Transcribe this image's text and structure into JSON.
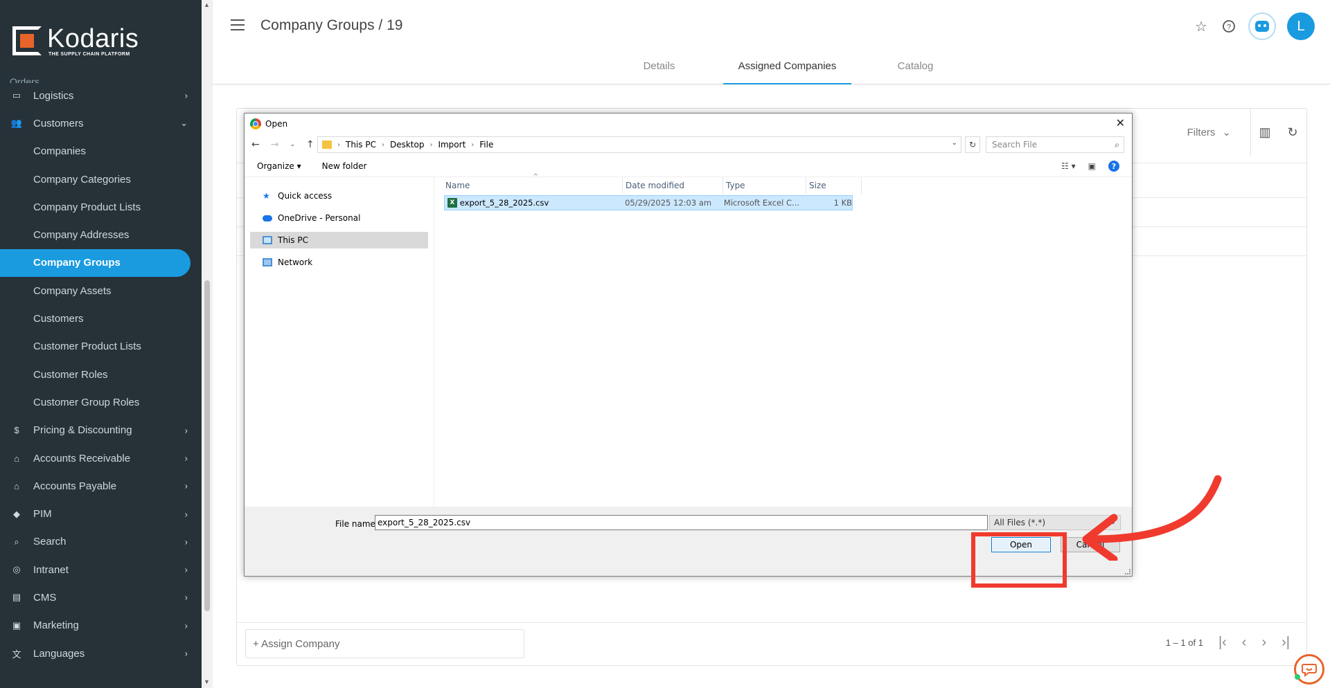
{
  "brand": {
    "name": "Kodaris",
    "tagline": "THE SUPPLY CHAIN PLATFORM",
    "accent": "#1a9be0",
    "logo_color": "#e8632a"
  },
  "sidebar": {
    "partial_item": "Orders",
    "items": [
      {
        "label": "Logistics",
        "icon": "truck-icon",
        "expandable": true
      },
      {
        "label": "Customers",
        "icon": "people-icon",
        "expandable": true,
        "expanded": true
      },
      {
        "label": "Companies",
        "sub": true
      },
      {
        "label": "Company Categories",
        "sub": true
      },
      {
        "label": "Company Product Lists",
        "sub": true
      },
      {
        "label": "Company Addresses",
        "sub": true
      },
      {
        "label": "Company Groups",
        "sub": true,
        "active": true
      },
      {
        "label": "Company Assets",
        "sub": true
      },
      {
        "label": "Customers",
        "sub": true
      },
      {
        "label": "Customer Product Lists",
        "sub": true
      },
      {
        "label": "Customer Roles",
        "sub": true
      },
      {
        "label": "Customer Group Roles",
        "sub": true
      },
      {
        "label": "Pricing & Discounting",
        "icon": "dollar-icon",
        "expandable": true
      },
      {
        "label": "Accounts Receivable",
        "icon": "bank-icon",
        "expandable": true
      },
      {
        "label": "Accounts Payable",
        "icon": "bank-icon",
        "expandable": true
      },
      {
        "label": "PIM",
        "icon": "tag-icon",
        "expandable": true
      },
      {
        "label": "Search",
        "icon": "search-icon",
        "expandable": true
      },
      {
        "label": "Intranet",
        "icon": "globe-icon",
        "expandable": true
      },
      {
        "label": "CMS",
        "icon": "cms-icon",
        "expandable": true
      },
      {
        "label": "Marketing",
        "icon": "megaphone-icon",
        "expandable": true
      },
      {
        "label": "Languages",
        "icon": "translate-icon",
        "expandable": true
      }
    ]
  },
  "header": {
    "title": "Company Groups / 19",
    "avatar_initial": "L",
    "tabs": [
      {
        "label": "Details",
        "active": false
      },
      {
        "label": "Assigned Companies",
        "active": true
      },
      {
        "label": "Catalog",
        "active": false
      }
    ]
  },
  "card": {
    "filters_label": "Filters",
    "assign_label": "+ Assign Company",
    "pager_text": "1 – 1 of 1"
  },
  "dialog": {
    "title": "Open",
    "breadcrumb": [
      "This PC",
      "Desktop",
      "Import",
      "File"
    ],
    "search_placeholder": "Search File",
    "organize_label": "Organize",
    "new_folder_label": "New folder",
    "nav_items": [
      {
        "label": "Quick access",
        "icon": "star-icon"
      },
      {
        "label": "OneDrive - Personal",
        "icon": "cloud-icon"
      },
      {
        "label": "This PC",
        "icon": "monitor-icon",
        "selected": true
      },
      {
        "label": "Network",
        "icon": "network-icon"
      }
    ],
    "columns": [
      "Name",
      "Date modified",
      "Type",
      "Size"
    ],
    "files": [
      {
        "name": "export_5_28_2025.csv",
        "date": "05/29/2025 12:03 am",
        "type": "Microsoft Excel C...",
        "size": "1 KB"
      }
    ],
    "file_name_label": "File name:",
    "file_name_value": "export_5_28_2025.csv",
    "file_type_value": "All Files (*.*)",
    "open_label": "Open",
    "cancel_label": "Cancel"
  },
  "annotation": {
    "color": "#f03a2e",
    "target": "open-button"
  }
}
